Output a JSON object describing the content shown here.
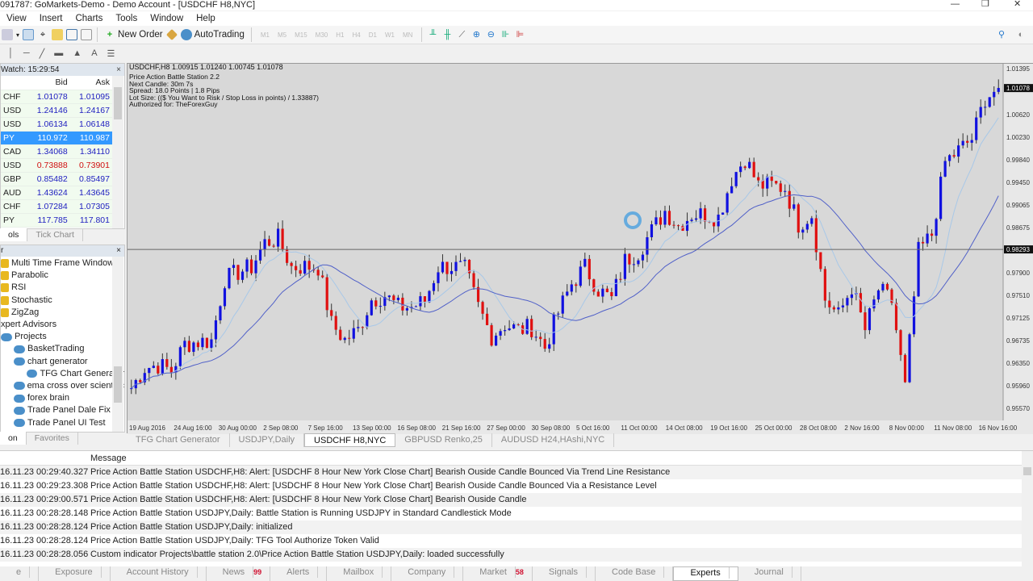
{
  "window": {
    "title": "091787: GoMarkets-Demo - Demo Account - [USDCHF H8,NYC]"
  },
  "menu": [
    "View",
    "Insert",
    "Charts",
    "Tools",
    "Window",
    "Help"
  ],
  "toolbar": {
    "new_order": "New Order",
    "autotrading": "AutoTrading",
    "timeframes": [
      "M1",
      "M5",
      "M15",
      "M30",
      "H1",
      "H4",
      "D1",
      "W1",
      "MN"
    ]
  },
  "market_watch": {
    "title": "Watch: 15:29:54",
    "col_bid": "Bid",
    "col_ask": "Ask",
    "rows": [
      {
        "sym": "CHF",
        "bid": "1.01078",
        "ask": "1.01095"
      },
      {
        "sym": "USD",
        "bid": "1.24146",
        "ask": "1.24167"
      },
      {
        "sym": "USD",
        "bid": "1.06134",
        "ask": "1.06148"
      },
      {
        "sym": "PY",
        "bid": "110.972",
        "ask": "110.987",
        "selected": true
      },
      {
        "sym": "CAD",
        "bid": "1.34068",
        "ask": "1.34110"
      },
      {
        "sym": "USD",
        "bid": "0.73888",
        "ask": "0.73901",
        "down": true
      },
      {
        "sym": "GBP",
        "bid": "0.85482",
        "ask": "0.85497"
      },
      {
        "sym": "AUD",
        "bid": "1.43624",
        "ask": "1.43645"
      },
      {
        "sym": "CHF",
        "bid": "1.07284",
        "ask": "1.07305"
      },
      {
        "sym": "PY",
        "bid": "117.785",
        "ask": "117.801"
      }
    ],
    "tabs": [
      "ols",
      "Tick Chart"
    ]
  },
  "navigator": {
    "title": "r",
    "items": [
      {
        "label": "Multi Time Frame Window",
        "kind": "ind",
        "lvl": 0
      },
      {
        "label": "Parabolic",
        "kind": "ind",
        "lvl": 0
      },
      {
        "label": "RSI",
        "kind": "ind",
        "lvl": 0
      },
      {
        "label": "Stochastic",
        "kind": "ind",
        "lvl": 0
      },
      {
        "label": "ZigZag",
        "kind": "ind",
        "lvl": 0
      },
      {
        "label": "xpert Advisors",
        "kind": "none",
        "lvl": -1
      },
      {
        "label": "Projects",
        "kind": "ea",
        "lvl": 0
      },
      {
        "label": "BasketTrading",
        "kind": "ea",
        "lvl": 1
      },
      {
        "label": "chart generator",
        "kind": "ea",
        "lvl": 1
      },
      {
        "label": "TFG Chart Generator",
        "kind": "ea",
        "lvl": 2
      },
      {
        "label": "ema cross over scientific",
        "kind": "ea",
        "lvl": 1
      },
      {
        "label": "forex brain",
        "kind": "ea",
        "lvl": 1
      },
      {
        "label": "Trade Panel Dale Fix",
        "kind": "ea",
        "lvl": 1
      },
      {
        "label": "Trade Panel UI Test",
        "kind": "ea",
        "lvl": 1
      }
    ],
    "tabs": [
      "on",
      "Favorites"
    ]
  },
  "chart": {
    "header": "USDCHF,H8  1.00915 1.01240 1.00745 1.01078",
    "info": [
      "Price Action Battle Station 2.2",
      "Next Candle: 30m 7s",
      "Spread: 18.0 Points | 1.8 Pips",
      "Lot Size: (($ You Want to Risk / Stop Loss in points) / 1.33887)",
      "Authorized for: TheForexGuy"
    ],
    "tabs": [
      "TFG Chart Generator",
      "USDJPY,Daily",
      "USDCHF H8,NYC",
      "GBPUSD Renko,25",
      "AUDUSD H24,HAshi,NYC"
    ],
    "active_tab": 2
  },
  "chart_data": {
    "type": "candlestick",
    "symbol": "USDCHF",
    "timeframe": "H8",
    "ylim": [
      0.9538,
      1.015
    ],
    "y_ticks": [
      "1.01395",
      "1.00620",
      "1.00230",
      "0.99840",
      "0.99450",
      "0.99065",
      "0.98675",
      "0.97900",
      "0.97510",
      "0.97125",
      "0.96735",
      "0.96350",
      "0.95960",
      "0.95570"
    ],
    "x_ticks": [
      "19 Aug 2016",
      "24 Aug 16:00",
      "30 Aug 00:00",
      "2 Sep 08:00",
      "7 Sep 16:00",
      "13 Sep 00:00",
      "16 Sep 08:00",
      "21 Sep 16:00",
      "27 Sep 00:00",
      "30 Sep 08:00",
      "5 Oct 16:00",
      "11 Oct 00:00",
      "14 Oct 08:00",
      "19 Oct 16:00",
      "25 Oct 00:00",
      "28 Oct 08:00",
      "2 Nov 16:00",
      "8 Nov 00:00",
      "11 Nov 08:00",
      "16 Nov 16:00"
    ],
    "current_price": "1.01078",
    "hline_price": "0.98293",
    "colors": {
      "bull": "#1010e0",
      "bear": "#e01010",
      "ma_fast": "#a8c8e8",
      "ma_slow": "#5060c8"
    },
    "closes": [
      0.959,
      0.9625,
      0.963,
      0.962,
      0.9666,
      0.967,
      0.9672,
      0.9778,
      0.979,
      0.9799,
      0.9841,
      0.9848,
      0.9799,
      0.98,
      0.9799,
      0.9701,
      0.9673,
      0.969,
      0.9743,
      0.975,
      0.973,
      0.973,
      0.974,
      0.9799,
      0.98,
      0.9795,
      0.973,
      0.968,
      0.97,
      0.969,
      0.9695,
      0.966,
      0.972,
      0.977,
      0.9799,
      0.976,
      0.9743,
      0.981,
      0.9825,
      0.9861,
      0.9896,
      0.987,
      0.989,
      0.989,
      0.9885,
      0.9952,
      0.9987,
      0.994,
      0.994,
      0.9935,
      0.9873,
      0.989,
      0.9743,
      0.9715,
      0.9765,
      0.969,
      0.976,
      0.974,
      0.959,
      0.9825,
      0.9855,
      0.998,
      1.0,
      1.002,
      1.0091,
      1.0108
    ]
  },
  "terminal": {
    "col_message": "Message",
    "rows": [
      {
        "time": "16.11.23 00:29:40.327",
        "msg": "Price Action Battle Station USDCHF,H8: Alert: [USDCHF 8 Hour New York Close Chart] Bearish Ouside Candle Bounced Via Trend Line Resistance"
      },
      {
        "time": "16.11.23 00:29:23.308",
        "msg": "Price Action Battle Station USDCHF,H8: Alert: [USDCHF 8 Hour New York Close Chart] Bearish Ouside Candle Bounced Via a Resistance Level"
      },
      {
        "time": "16.11.23 00:29:00.571",
        "msg": "Price Action Battle Station USDCHF,H8: Alert: [USDCHF 8 Hour New York Close Chart] Bearish Ouside Candle"
      },
      {
        "time": "16.11.23 00:28:28.148",
        "msg": "Price Action Battle Station USDJPY,Daily: Battle Station is Running USDJPY in Standard Candlestick Mode"
      },
      {
        "time": "16.11.23 00:28:28.124",
        "msg": "Price Action Battle Station USDJPY,Daily: initialized"
      },
      {
        "time": "16.11.23 00:28:28.124",
        "msg": "Price Action Battle Station USDJPY,Daily: TFG Tool Authorize Token Valid"
      },
      {
        "time": "16.11.23 00:28:28.056",
        "msg": "Custom indicator Projects\\battle station 2.0\\Price Action Battle Station USDJPY,Daily: loaded successfully"
      }
    ],
    "tabs": [
      {
        "label": "e"
      },
      {
        "label": "Exposure"
      },
      {
        "label": "Account History"
      },
      {
        "label": "News",
        "badge": "99"
      },
      {
        "label": "Alerts"
      },
      {
        "label": "Mailbox"
      },
      {
        "label": "Company"
      },
      {
        "label": "Market",
        "badge": "58"
      },
      {
        "label": "Signals"
      },
      {
        "label": "Code Base"
      },
      {
        "label": "Experts",
        "active": true
      },
      {
        "label": "Journal"
      }
    ]
  }
}
